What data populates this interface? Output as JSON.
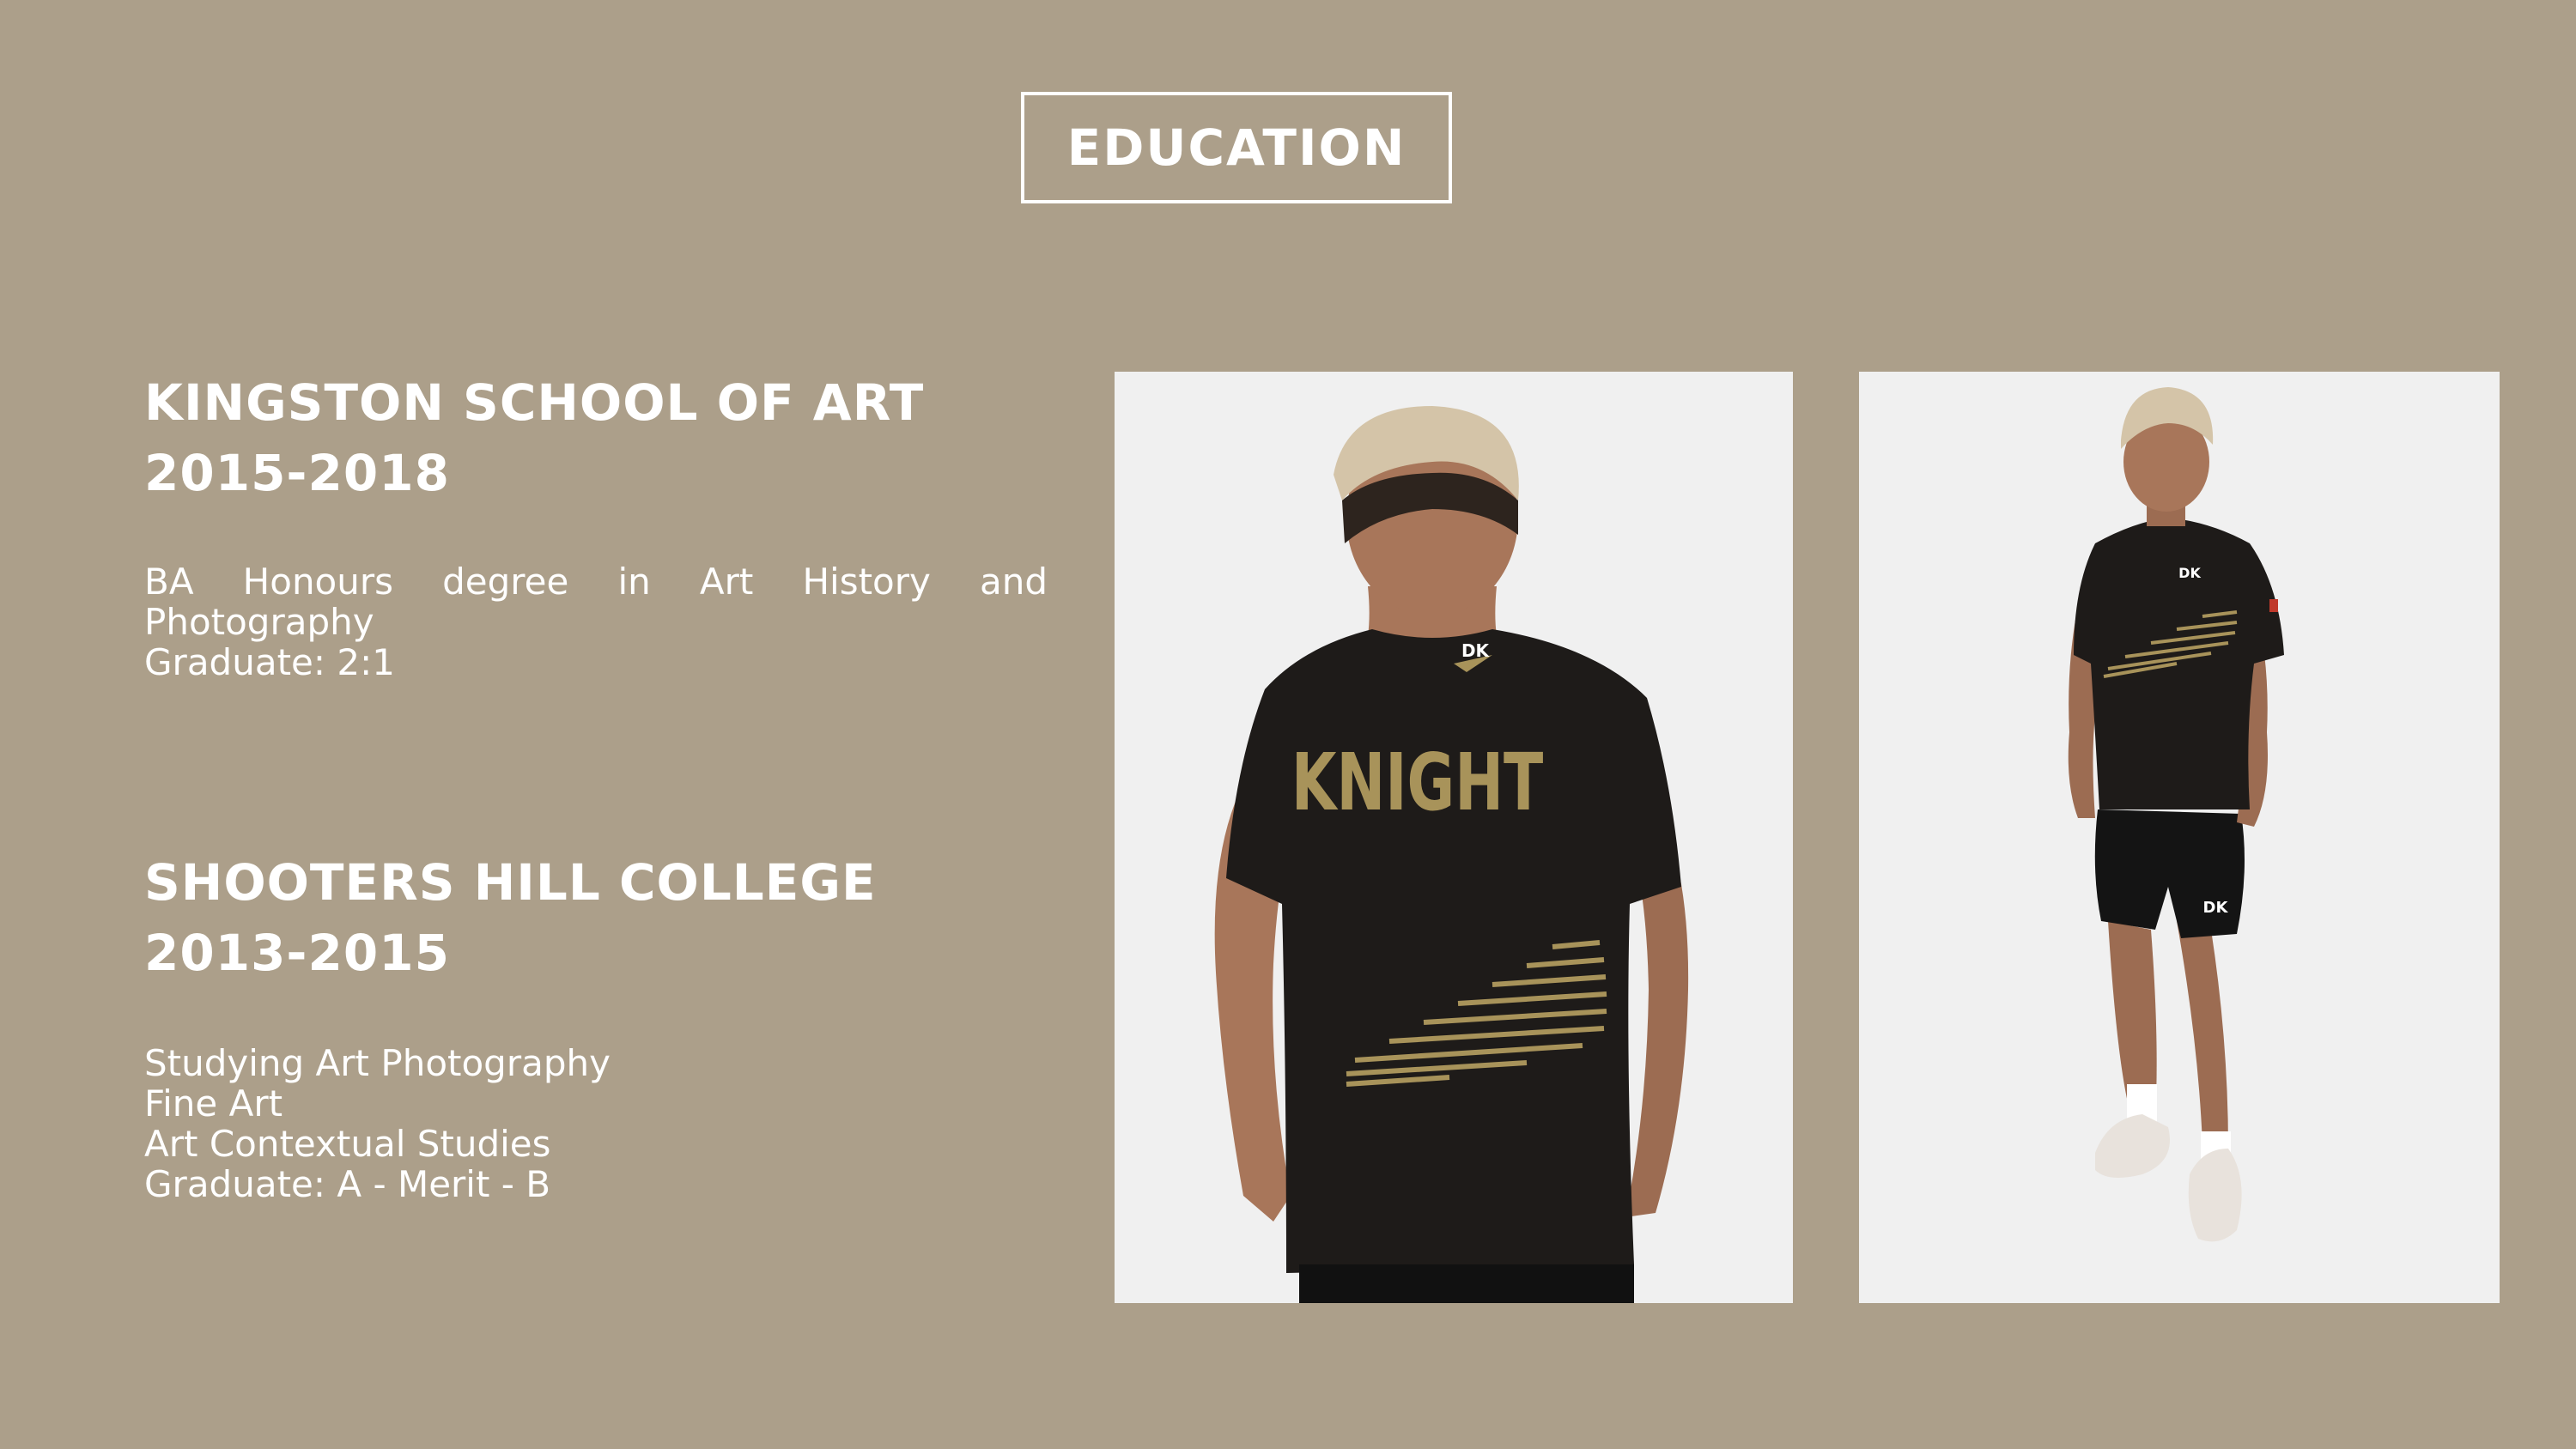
{
  "title": "EDUCATION",
  "education": [
    {
      "school": "KINGSTON SCHOOL OF ART",
      "years": "2015-2018",
      "lines": [
        "BA Honours degree in Art History and",
        "Photography",
        "Graduate: 2:1"
      ]
    },
    {
      "school": "SHOOTERS HILL COLLEGE",
      "years": "2013-2015",
      "lines": [
        "Studying Art Photography",
        "Fine Art",
        "Art Contextual Studies",
        "Graduate: A - Merit - B"
      ]
    }
  ],
  "photos": {
    "back_shirt_text": "KNIGHT",
    "logo_text": "DK"
  },
  "colors": {
    "background": "#ac9f8a",
    "text": "#ffffff",
    "photo_bg": "#f0f0f0",
    "shirt": "#1e1b19",
    "gold": "#a8935a"
  }
}
